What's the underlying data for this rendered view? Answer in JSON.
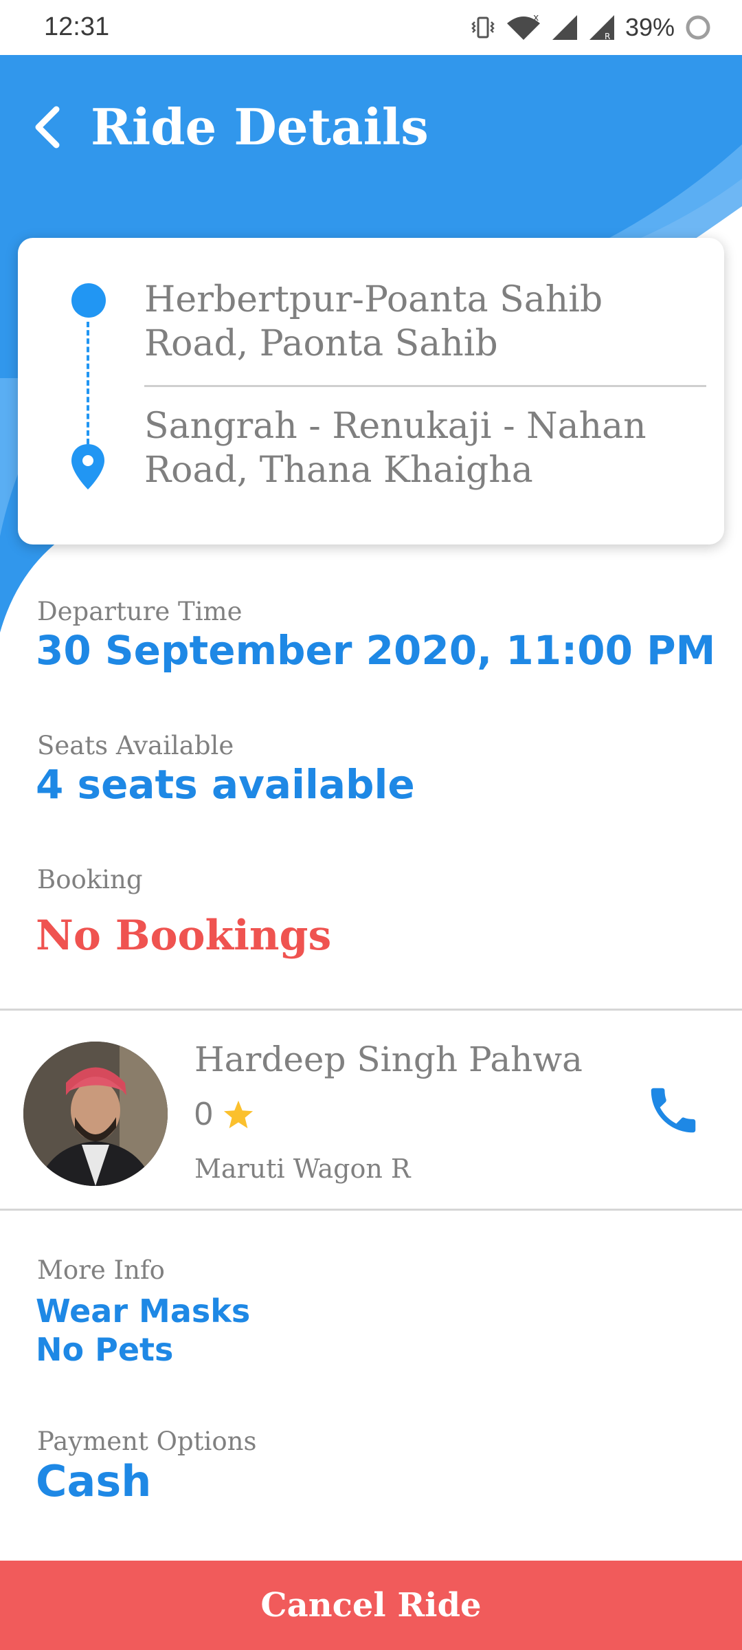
{
  "status_bar": {
    "time": "12:31",
    "battery": "39%",
    "icons": [
      "vibrate-icon",
      "wifi-icon",
      "signal-icon",
      "signal-roaming-icon",
      "battery-icon"
    ]
  },
  "header": {
    "title": "Ride Details",
    "back_icon": "back-arrow-icon",
    "color": "#3197ec"
  },
  "route": {
    "from": "Herbertpur-Poanta Sahib Road, Paonta Sahib",
    "to": "Sangrah - Renukaji - Nahan Road, Thana Khaigha"
  },
  "departure": {
    "label": "Departure Time",
    "value": "30 September 2020, 11:00 PM"
  },
  "seats": {
    "label": "Seats Available",
    "value": "4 seats available"
  },
  "booking": {
    "label": "Booking",
    "value": "No Bookings"
  },
  "driver": {
    "name": "Hardeep Singh Pahwa",
    "rating": "0",
    "car": "Maruti Wagon R",
    "call_icon": "phone-icon"
  },
  "more_info": {
    "label": "More Info",
    "items": [
      "Wear Masks",
      "No Pets"
    ]
  },
  "payment": {
    "label": "Payment Options",
    "value": "Cash"
  },
  "actions": {
    "cancel_label": "Cancel Ride"
  },
  "colors": {
    "accent_blue": "#1e88e5",
    "header_blue": "#3197ec",
    "danger_red": "#f15b5b",
    "star_yellow": "#fbc02d"
  }
}
